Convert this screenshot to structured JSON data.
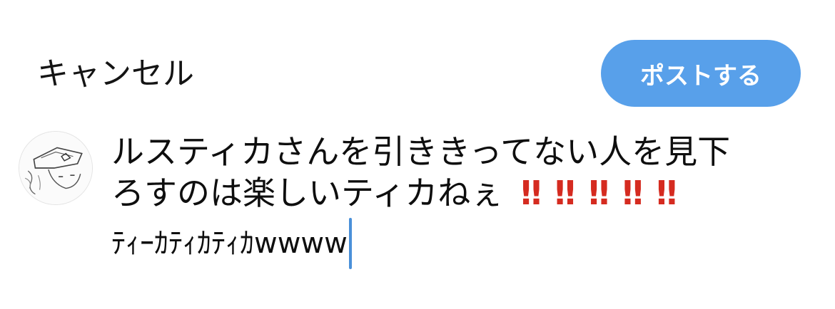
{
  "header": {
    "cancel_label": "キャンセル",
    "post_label": "ポストする"
  },
  "composer": {
    "line1": "ルスティカさんを引ききってない人を見下",
    "line2_text": "ろすのは楽しいティカねぇ",
    "line2_emphasis": [
      "‼",
      "‼",
      "‼",
      "‼",
      "‼"
    ],
    "line3": "ﾃｨｰｶﾃｨｶﾃｨｶwwww"
  },
  "icons": {
    "avatar": "user-avatar-sketch"
  },
  "colors": {
    "accent": "#58a0ea",
    "emphasis": "#d52b20",
    "caret": "#4a90d9"
  }
}
